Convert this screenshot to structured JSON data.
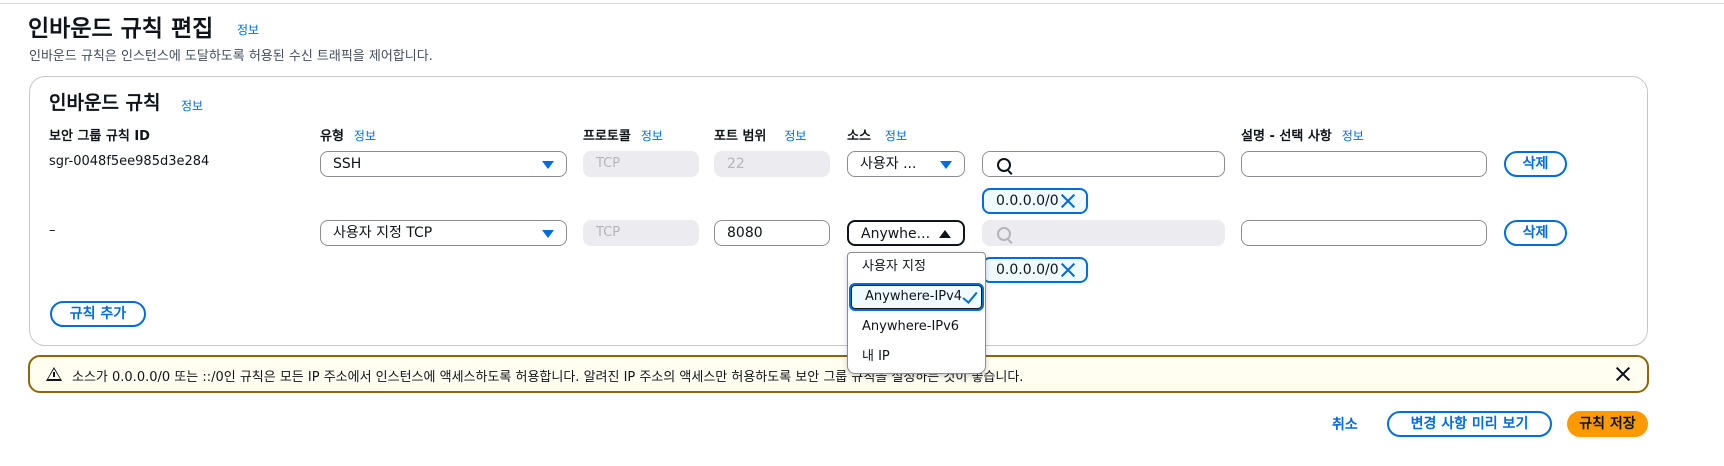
{
  "header": {
    "title": "인바운드 규칙 편집",
    "info": "정보",
    "description": "인바운드 규칙은 인스턴스에 도달하도록 허용된 수신 트래픽을 제어합니다."
  },
  "panel": {
    "title": "인바운드 규칙",
    "info": "정보",
    "columns": {
      "rule_id": "보안 그룹 규칙 ID",
      "type": "유형",
      "protocol": "프로토콜",
      "port_range": "포트 범위",
      "source": "소스",
      "description": "설명 - 선택 사항",
      "info": "정보"
    },
    "rows": [
      {
        "rule_id": "sgr-0048f5ee985d3e284",
        "type": "SSH",
        "protocol": "TCP",
        "port_range": "22",
        "source": "사용자 ...",
        "search_value": "",
        "token": "0.0.0.0/0",
        "description": "",
        "delete_label": "삭제"
      },
      {
        "rule_id": "–",
        "type": "사용자 지정 TCP",
        "protocol": "TCP",
        "port_range": "8080",
        "source": "Anywhe...",
        "search_value": "",
        "token": "0.0.0.0/0",
        "description": "",
        "delete_label": "삭제"
      }
    ],
    "source_dropdown": {
      "options": [
        "사용자 지정",
        "Anywhere-IPv4",
        "Anywhere-IPv6",
        "내 IP"
      ],
      "selected": "Anywhere-IPv4"
    },
    "add_rule_label": "규칙 추가"
  },
  "alert": {
    "text": "소스가 0.0.0.0/0 또는 ::/0인 규칙은 모든 IP 주소에서 인스턴스에 액세스하도록 허용합니다. 알려진 IP 주소의 액세스만 허용하도록 보안 그룹 규칙을 설정하는 것이 좋습니다."
  },
  "footer": {
    "cancel_label": "취소",
    "preview_label": "변경 사항 미리 보기",
    "save_label": "규칙 저장"
  },
  "colors": {
    "accent": "#006ce0",
    "primary_button": "#ff9900",
    "warning_border": "#8d6605"
  }
}
